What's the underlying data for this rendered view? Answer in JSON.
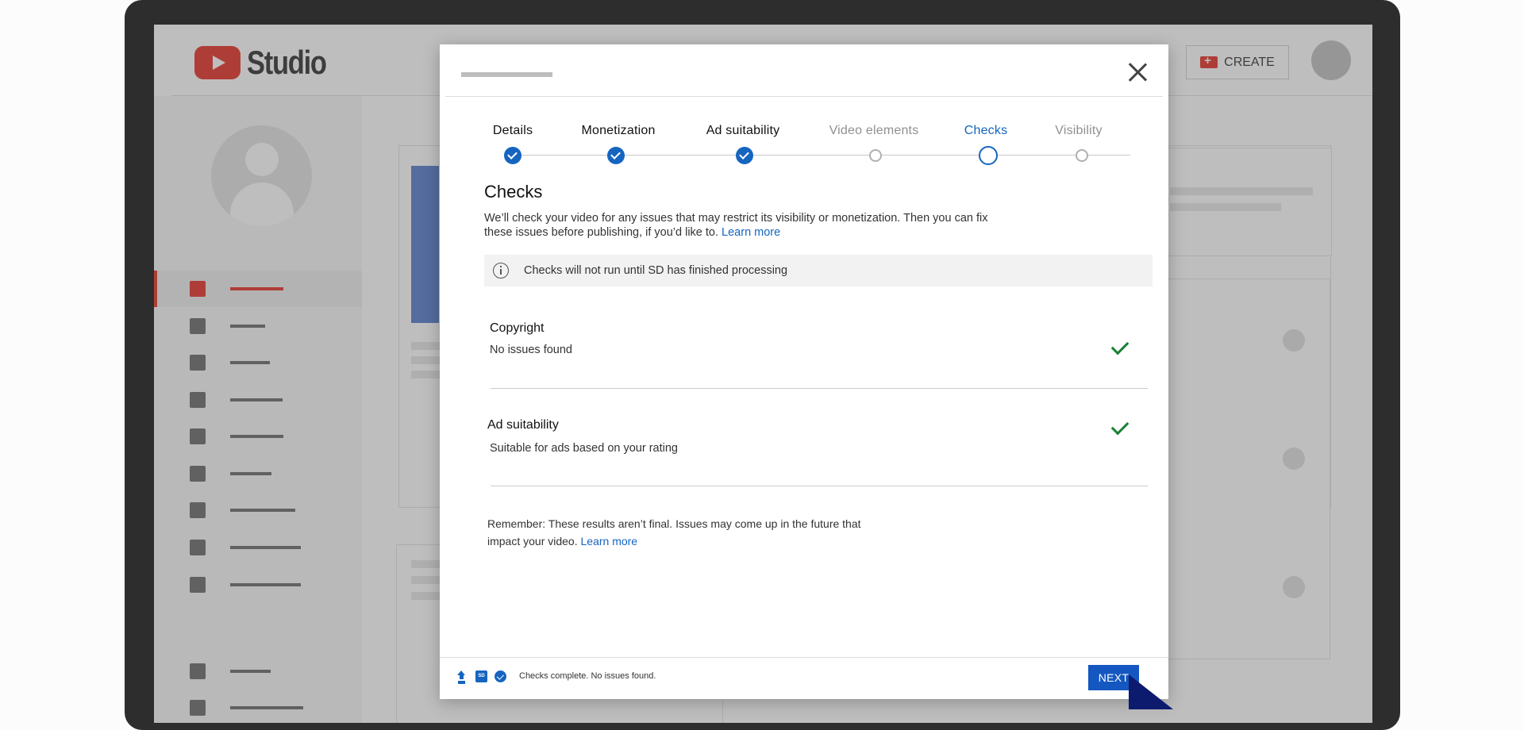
{
  "app": {
    "logo_text": "Studio",
    "create_label": "CREATE"
  },
  "dialog": {
    "steps": [
      {
        "label": "Details",
        "state": "done"
      },
      {
        "label": "Monetization",
        "state": "done"
      },
      {
        "label": "Ad suitability",
        "state": "done"
      },
      {
        "label": "Video elements",
        "state": "pending"
      },
      {
        "label": "Checks",
        "state": "current"
      },
      {
        "label": "Visibility",
        "state": "pending"
      }
    ],
    "section_title": "Checks",
    "description": "We’ll check your video for any issues that may restrict its visibility or monetization. Then you can fix these issues before publishing, if you’d like to.",
    "learn_more": "Learn more",
    "info_text": "Checks will not run until SD has finished processing",
    "checks": [
      {
        "title": "Copyright",
        "status": "No issues found"
      },
      {
        "title": "Ad suitability",
        "status": "Suitable for ads based on your rating"
      }
    ],
    "remember_text": "Remember: These results aren’t final. Issues may come up in the future that impact your video.",
    "remember_link": "Learn more",
    "footer_sd_label": "SD",
    "footer_status": "Checks complete. No issues found.",
    "next_label": "NEXT"
  },
  "colors": {
    "accent_blue": "#1565c0",
    "brand_red": "#e62117",
    "success_green": "#188038"
  }
}
